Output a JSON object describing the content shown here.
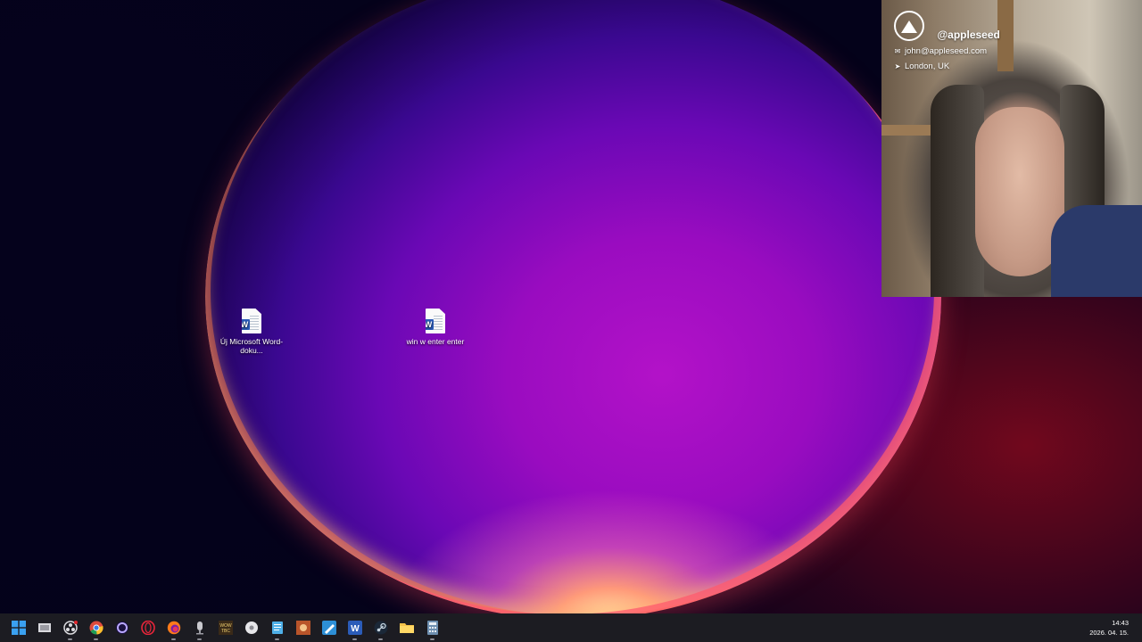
{
  "desktop": {
    "icons": [
      {
        "label": "Új Microsoft Word-doku...",
        "icon": "word-document-icon"
      },
      {
        "label": "win w enter enter",
        "icon": "word-document-icon"
      }
    ]
  },
  "webcam": {
    "handle": "@appleseed",
    "email": "john@appleseed.com",
    "location": "London, UK"
  },
  "taskbar": {
    "apps": [
      "start-icon",
      "task-view-icon",
      "obs-icon",
      "chrome-icon",
      "cortana-icon",
      "opera-icon",
      "firefox-icon",
      "microphone-icon",
      "game-launcher-icon",
      "disc-app-icon",
      "notepad-icon",
      "game-icon",
      "paint-icon",
      "word-icon",
      "steam-icon",
      "file-explorer-icon",
      "calculator-icon"
    ],
    "time": "14:43",
    "date": "2026. 04. 15."
  }
}
